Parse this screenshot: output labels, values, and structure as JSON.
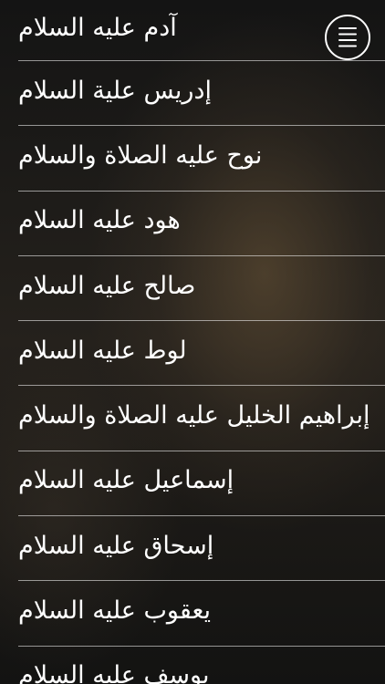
{
  "menu": {
    "icon": "hamburger-menu-icon"
  },
  "items": [
    {
      "label": "آدم عليه السلام"
    },
    {
      "label": "إدريس علية السلام"
    },
    {
      "label": "نوح عليه الصلاة والسلام"
    },
    {
      "label": "هود عليه السلام"
    },
    {
      "label": "صالح عليه السلام"
    },
    {
      "label": "لوط عليه السلام"
    },
    {
      "label": "إبراهيم الخليل عليه الصلاة والسلام"
    },
    {
      "label": "إسماعيل عليه السلام"
    },
    {
      "label": "إسحاق عليه السلام"
    },
    {
      "label": "يعقوب عليه السلام"
    },
    {
      "label": "يوسف عليه السلام"
    }
  ]
}
